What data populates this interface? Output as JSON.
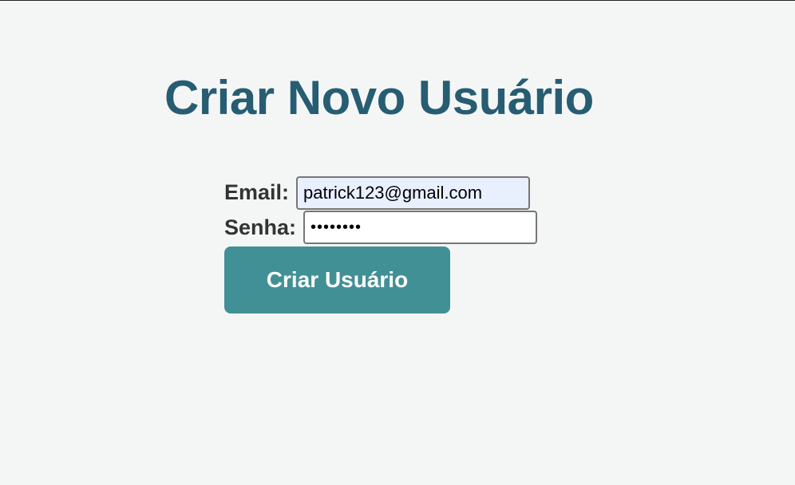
{
  "page": {
    "title": "Criar Novo Usuário"
  },
  "form": {
    "email_label": "Email:",
    "email_value": "patrick123@gmail.com",
    "password_label": "Senha:",
    "password_value": "12345678",
    "submit_label": "Criar Usuário"
  },
  "colors": {
    "title": "#275d72",
    "button": "#419095",
    "background": "#f4f6f6",
    "autofill": "#e8f0fe"
  }
}
